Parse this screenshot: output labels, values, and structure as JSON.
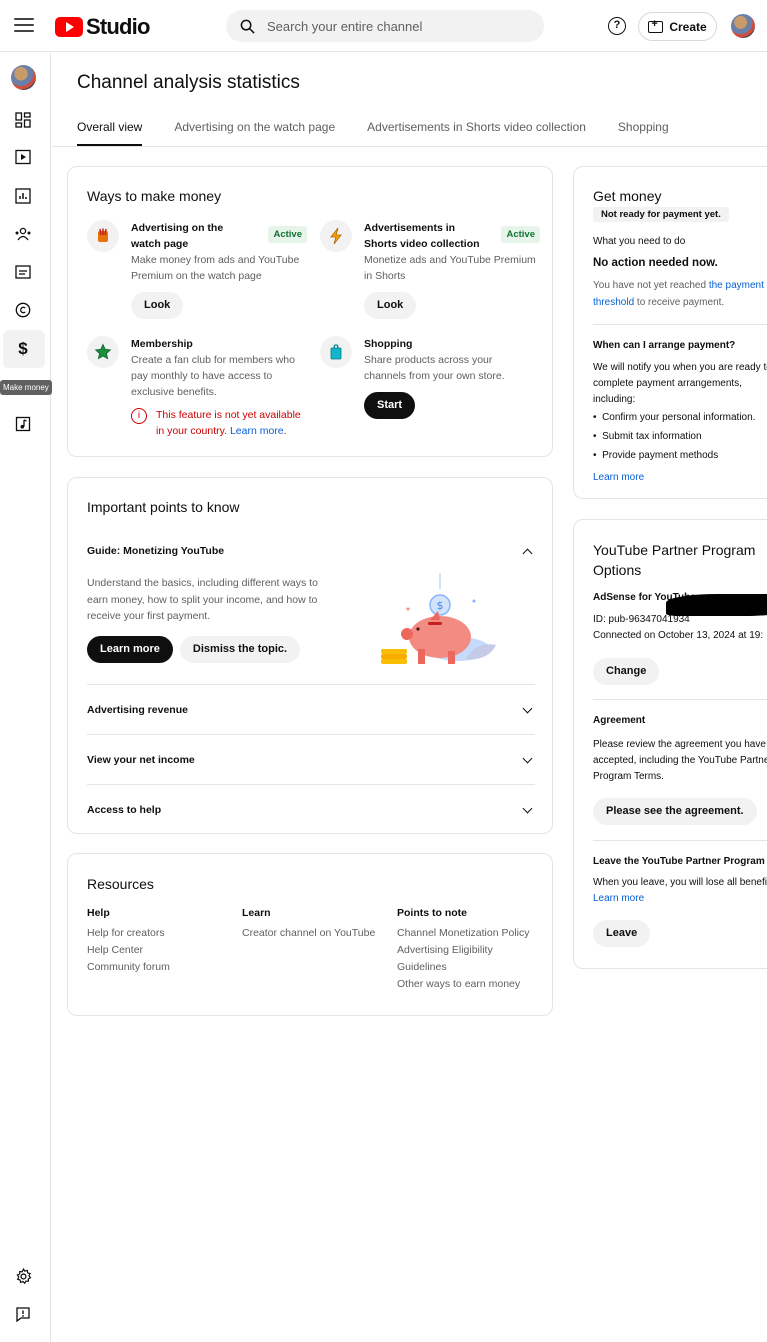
{
  "app": {
    "logo_text": "Studio",
    "logo_color": "#ff0000"
  },
  "search": {
    "placeholder": "Search your entire channel"
  },
  "header": {
    "help": "?",
    "create_label": "Create"
  },
  "rail": {
    "tooltip": "Make money"
  },
  "page": {
    "title": "Channel analysis statistics",
    "tabs": [
      {
        "label": "Overall view",
        "active": true
      },
      {
        "label": "Advertising on the watch page"
      },
      {
        "label": "Advertisements in Shorts video collection"
      },
      {
        "label": "Shopping"
      }
    ]
  },
  "ways": {
    "title": "Ways to make money",
    "watch_ads": {
      "title": "Advertising on the watch page",
      "badge": "Active",
      "desc": "Make money from ads and YouTube Premium on the watch page",
      "button": "Look"
    },
    "shorts_ads": {
      "title": "Advertisements in Shorts video collection",
      "badge": "Active",
      "desc": "Monetize ads and YouTube Premium in Shorts",
      "button": "Look"
    },
    "membership": {
      "title": "Membership",
      "desc": "Create a fan club for members who pay monthly to have access to exclusive benefits.",
      "warning": "This feature is not yet available in your country.",
      "warning_link": "Learn more",
      "warning_tail": "."
    },
    "shopping": {
      "title": "Shopping",
      "desc": "Share products across your channels from your own store.",
      "button": "Start"
    }
  },
  "important": {
    "title": "Important points to know",
    "guide": {
      "title": "Guide: Monetizing YouTube",
      "text": "Understand the basics, including different ways to earn money, how to split your income, and how to receive your first payment.",
      "learn_more": "Learn more",
      "dismiss": "Dismiss the topic."
    },
    "items": [
      "Advertising revenue",
      "View your net income",
      "Access to help"
    ]
  },
  "resources": {
    "title": "Resources",
    "help": {
      "title": "Help",
      "links": [
        "Help for creators",
        "Help Center",
        "Community forum"
      ]
    },
    "learn": {
      "title": "Learn",
      "links": [
        "Creator channel on YouTube"
      ]
    },
    "points": {
      "title": "Points to note",
      "links": [
        "Channel Monetization Policy",
        "Advertising Eligibility Guidelines",
        "Other ways to earn money"
      ]
    }
  },
  "get_money": {
    "title": "Get money",
    "status": "Not ready for payment yet.",
    "what_label": "What you need to do",
    "no_action": "No action needed now.",
    "threshold_pre": "You have not yet reached ",
    "threshold_link1": "the payment",
    "threshold_link2": "threshold",
    "threshold_post": " to receive payment.",
    "when_title": "When can I arrange payment?",
    "when_text": [
      "We will notify you when you are ready to",
      "complete payment arrangements,",
      "including:"
    ],
    "steps": [
      "Confirm your personal information.",
      "Submit tax information",
      "Provide payment methods"
    ],
    "learn_more": "Learn more"
  },
  "partner": {
    "title_line1": "YouTube Partner Program",
    "title_line2": "Options",
    "adsense_label": "AdSense for YouTube",
    "id": "ID: pub-96347041934",
    "connected": "Connected on October 13, 2024 at 19:",
    "change": "Change",
    "agreement_title": "Agreement",
    "agreement_text": [
      "Please review the agreement you have",
      "accepted, including the YouTube Partner",
      "Program Terms."
    ],
    "agreement_button": "Please see the agreement.",
    "leave_title": "Leave the YouTube Partner Program",
    "leave_text": "When you leave, you will lose all benefits.",
    "leave_link": "Learn more",
    "leave_button": "Leave"
  }
}
